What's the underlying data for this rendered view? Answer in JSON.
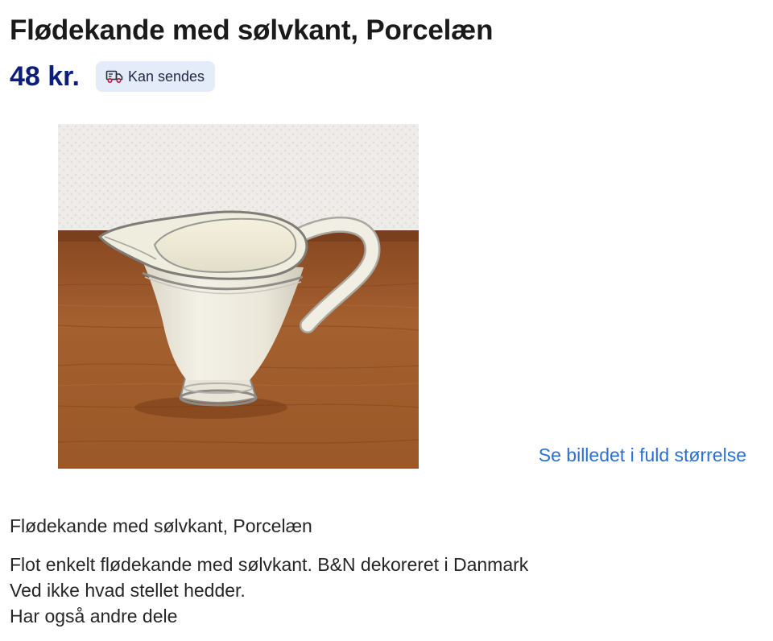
{
  "listing": {
    "title": "Flødekande med sølvkant, Porcelæn",
    "price": "48 kr.",
    "shipping_badge": {
      "label": "Kan sendes",
      "icon": "delivery-truck-icon"
    },
    "image": {
      "alt": "Flødekande med sølvkant, Porcelæn"
    },
    "fullsize_link": "Se billedet i fuld størrelse",
    "description": {
      "heading": "Flødekande med sølvkant, Porcelæn",
      "lines": [
        "Flot enkelt flødekande med sølvkant. B&N dekoreret i Danmark",
        "Ved ikke hvad stellet hedder.",
        "Har også andre dele"
      ]
    }
  },
  "colors": {
    "price": "#0b1f7a",
    "link": "#2c6fd6",
    "badge_bg": "#e3ecf8"
  }
}
